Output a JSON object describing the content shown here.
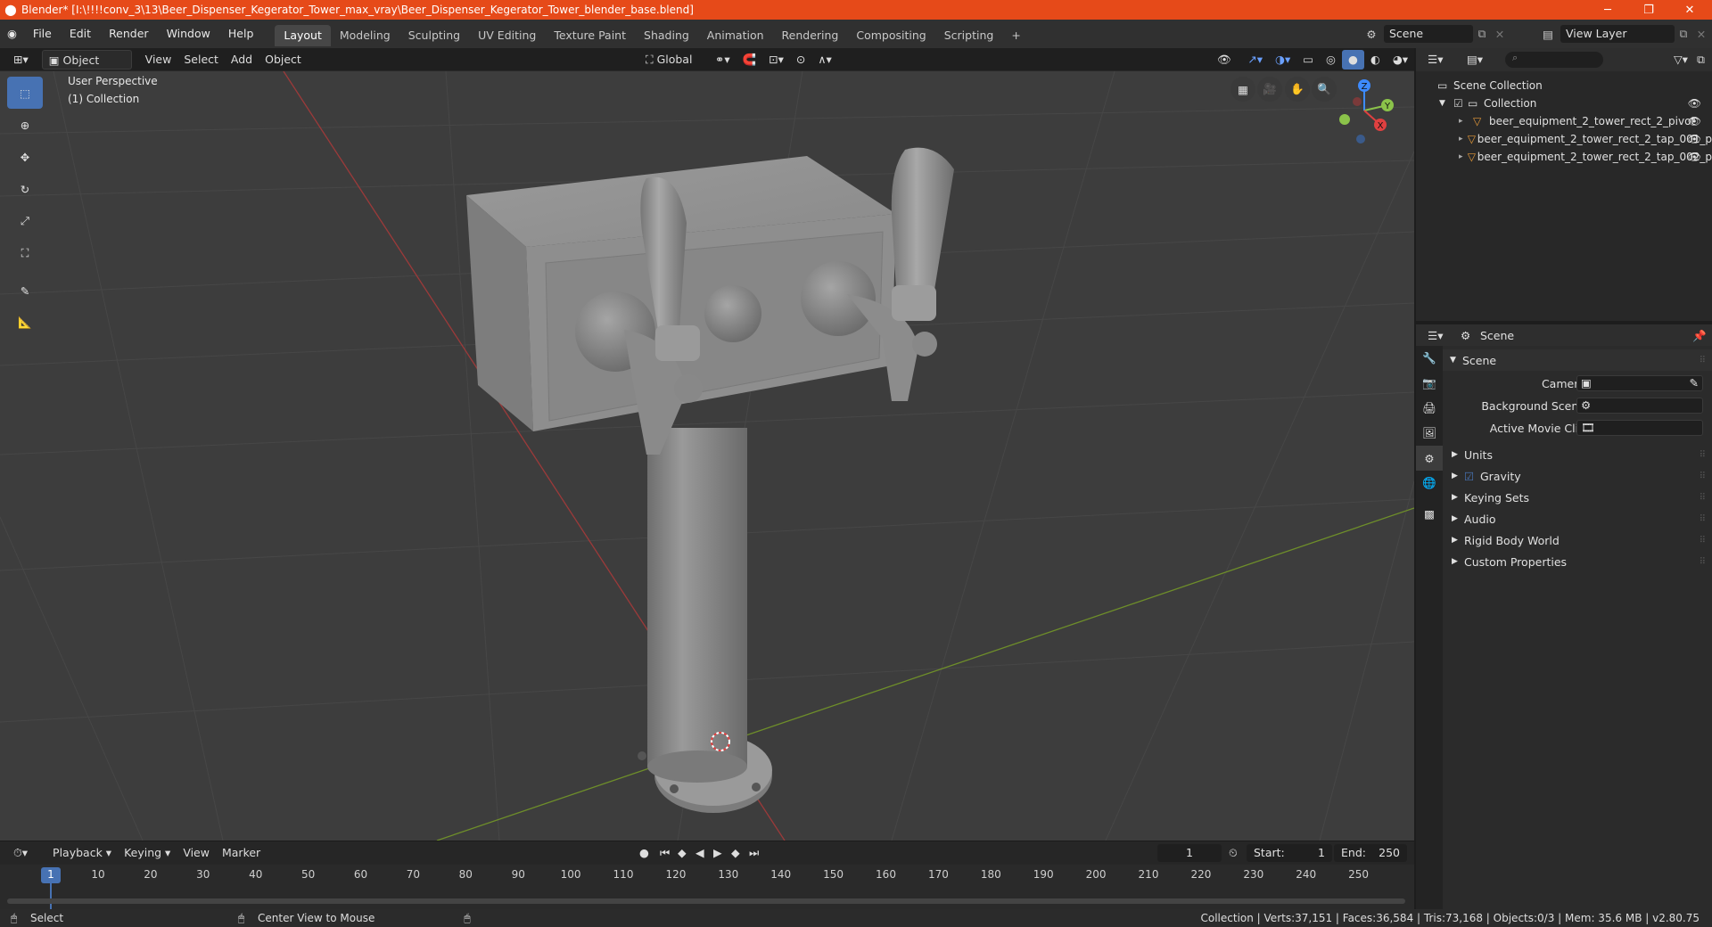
{
  "window": {
    "title": "Blender* [I:\\!!!!conv_3\\13\\Beer_Dispenser_Kegerator_Tower_max_vray\\Beer_Dispenser_Kegerator_Tower_blender_base.blend]",
    "controls": [
      "minimize-icon",
      "maximize-icon",
      "close-icon"
    ]
  },
  "menubar": {
    "menus": [
      "File",
      "Edit",
      "Render",
      "Window",
      "Help"
    ],
    "workspaces": [
      "Layout",
      "Modeling",
      "Sculpting",
      "UV Editing",
      "Texture Paint",
      "Shading",
      "Animation",
      "Rendering",
      "Compositing",
      "Scripting"
    ],
    "active_workspace": "Layout",
    "add_workspace": "+",
    "scene_name": "Scene",
    "view_layer": "View Layer"
  },
  "viewport_header": {
    "mode": "Object Mode",
    "menus": [
      "View",
      "Select",
      "Add",
      "Object"
    ],
    "orientation": "Global"
  },
  "viewport": {
    "overlay_line1": "User Perspective",
    "overlay_line2": "(1) Collection",
    "gizmo_labels": {
      "x": "X",
      "y": "Y",
      "z": "Z"
    }
  },
  "outliner": {
    "root": "Scene Collection",
    "collection": "Collection",
    "items": [
      "beer_equipment_2_tower_rect_2_pivot",
      "beer_equipment_2_tower_rect_2_tap_001_p",
      "beer_equipment_2_tower_rect_2_tap_002_p"
    ]
  },
  "properties": {
    "header": "Scene",
    "panel": "Scene",
    "fields": {
      "camera": "Camera",
      "background_scene": "Background Scene",
      "active_movie_clip": "Active Movie Clip"
    },
    "sections": [
      "Units",
      "Gravity",
      "Keying Sets",
      "Audio",
      "Rigid Body World",
      "Custom Properties"
    ],
    "gravity_checked": true
  },
  "timeline": {
    "menus": [
      "Playback",
      "Keying",
      "View",
      "Marker"
    ],
    "current_frame": "1",
    "start_label": "Start:",
    "start": "1",
    "end_label": "End:",
    "end": "250",
    "ruler": [
      "1",
      "10",
      "20",
      "30",
      "40",
      "50",
      "60",
      "70",
      "80",
      "90",
      "100",
      "110",
      "120",
      "130",
      "140",
      "150",
      "160",
      "170",
      "180",
      "190",
      "200",
      "210",
      "220",
      "230",
      "240",
      "250"
    ]
  },
  "statusbar": {
    "select": "Select",
    "center": "Center View to Mouse",
    "stats": "Collection | Verts:37,151 | Faces:36,584 | Tris:73,168 | Objects:0/3 | Mem: 35.6 MB | v2.80.75"
  },
  "colors": {
    "titlebar": "#e64a19",
    "accent": "#4772b3",
    "x_axis": "#e04040",
    "y_axis": "#8bc34a",
    "z_axis": "#3d8bff"
  }
}
